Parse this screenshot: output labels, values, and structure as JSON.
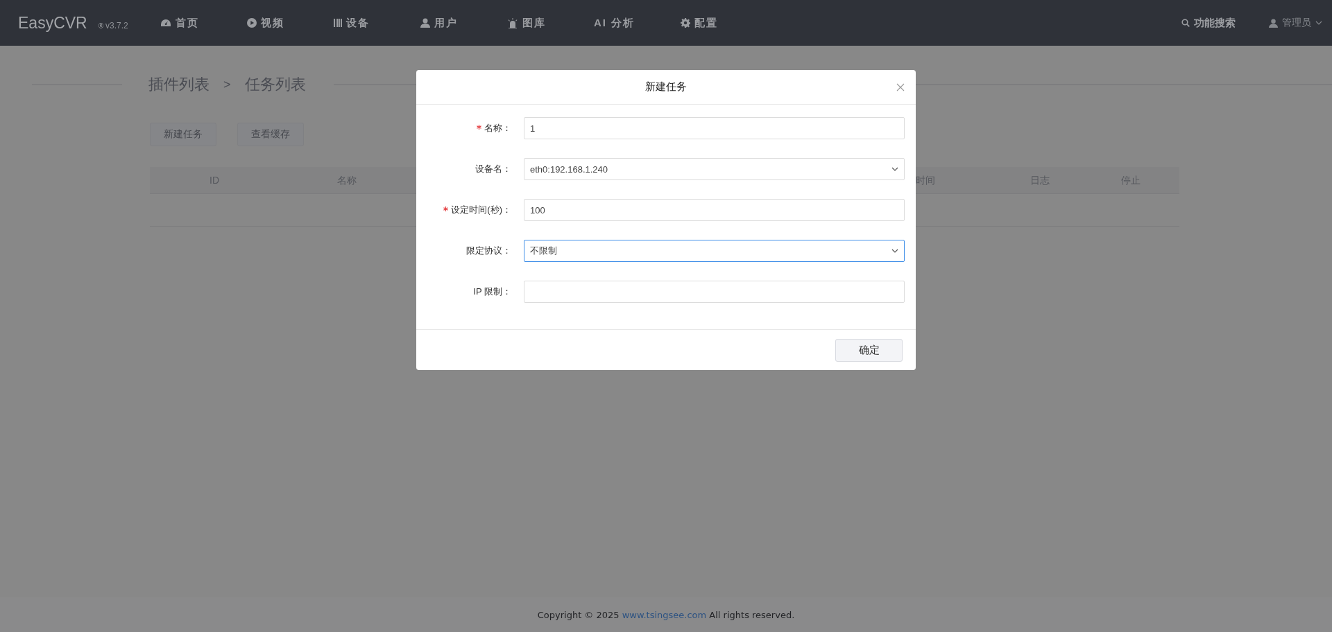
{
  "nav": {
    "logo": "EasyCVR",
    "registered_mark": "®",
    "version": "v3.7.2",
    "items": [
      {
        "label": "首页"
      },
      {
        "label": "视频"
      },
      {
        "label": "设备"
      },
      {
        "label": "用户"
      },
      {
        "label": "图库"
      },
      {
        "label": "AI 分析"
      },
      {
        "label": "配置"
      }
    ],
    "search": "功能搜索",
    "user": "管理员"
  },
  "breadcrumb": [
    "插件列表",
    ">",
    "任务列表"
  ],
  "toolbar": [
    "新建任务",
    "查看缓存"
  ],
  "table": {
    "columns": [
      {
        "label": "ID"
      },
      {
        "label": "名称"
      },
      {
        "label": "时间"
      },
      {
        "label": "日志"
      },
      {
        "label": "停止"
      }
    ]
  },
  "modal": {
    "title": "新建任务",
    "fields": [
      {
        "label": "名称：",
        "required": true,
        "kind": "input",
        "value": "1",
        "focused": false
      },
      {
        "label": "设备名：",
        "required": false,
        "kind": "select",
        "value": "eth0:192.168.1.240",
        "focused": false
      },
      {
        "label": "设定时间(秒)：",
        "required": true,
        "kind": "input",
        "value": "100",
        "focused": false
      },
      {
        "label": "限定协议：",
        "required": false,
        "kind": "select",
        "value": "不限制",
        "focused": true
      },
      {
        "label": "IP 限制：",
        "required": false,
        "kind": "input",
        "focused": false
      }
    ],
    "confirm": "确定"
  },
  "footer": {
    "before": "Copyright © 2025 ",
    "link": "www.tsingsee.com",
    "after": " All rights reserved."
  }
}
